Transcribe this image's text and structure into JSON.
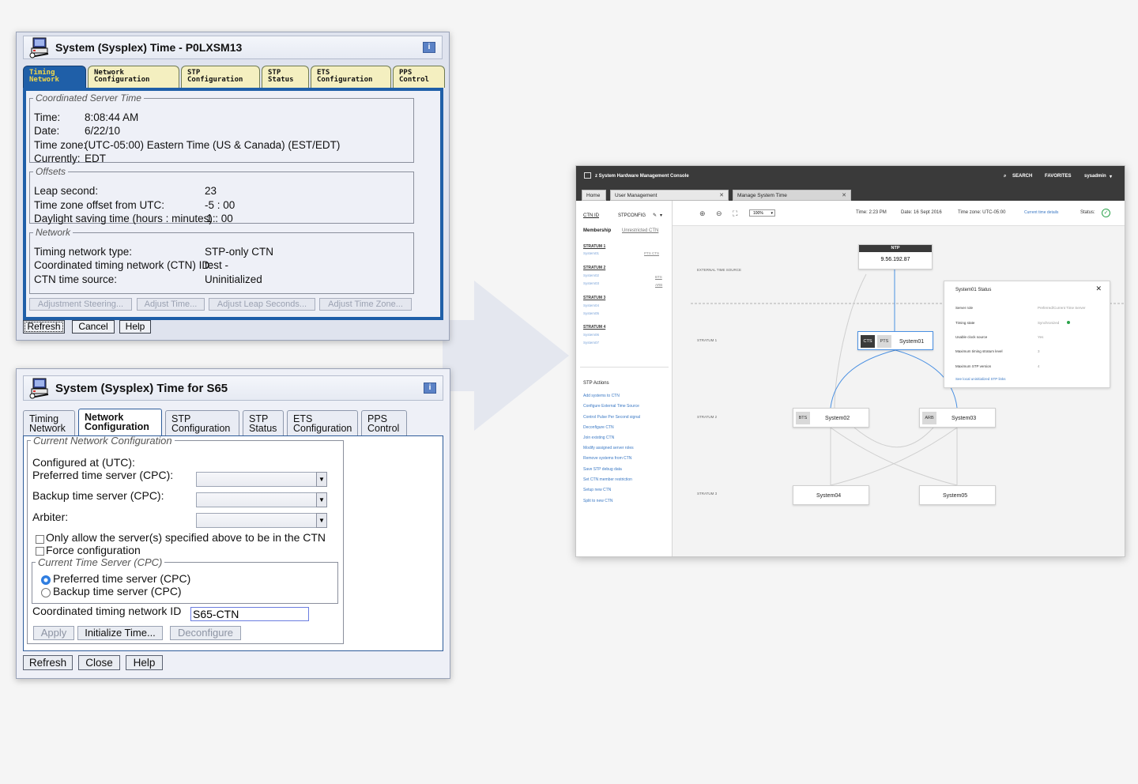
{
  "dialog1": {
    "title": "System (Sysplex) Time - P0LXSM13",
    "info_icon": "info-icon",
    "tabs": [
      {
        "line1": "Timing",
        "line2": "Network",
        "active": true
      },
      {
        "line1": "Network",
        "line2": "Configuration",
        "active": false
      },
      {
        "line1": "STP",
        "line2": "Configuration",
        "active": false
      },
      {
        "line1": "STP",
        "line2": "Status",
        "active": false
      },
      {
        "line1": "ETS",
        "line2": "Configuration",
        "active": false
      },
      {
        "line1": "PPS",
        "line2": "Control",
        "active": false
      }
    ],
    "cst": {
      "legend": "Coordinated Server Time",
      "time_label": "Time:",
      "time_value": "8:08:44 AM",
      "date_label": "Date:",
      "date_value": "6/22/10",
      "tz_label": "Time zone:",
      "tz_value": "(UTC-05:00) Eastern Time (US & Canada) (EST/EDT)",
      "currently_label": "Currently:",
      "currently_value": "EDT"
    },
    "offsets": {
      "legend": "Offsets",
      "leap_label": "Leap second:",
      "leap_value": "23",
      "tz_offset_label": "Time zone offset from UTC:",
      "tz_offset_value": "-5 : 00",
      "dst_label": "Daylight saving time (hours : minutes):",
      "dst_value": "1 : 00"
    },
    "network": {
      "legend": "Network",
      "type_label": "Timing network type:",
      "type_value": "STP-only CTN",
      "ctn_label": "Coordinated timing network (CTN) ID:",
      "ctn_value": "test -",
      "source_label": "CTN time source:",
      "source_value": "Uninitialized"
    },
    "actions": [
      "Adjustment Steering...",
      "Adjust Time...",
      "Adjust Leap Seconds...",
      "Adjust Time Zone..."
    ],
    "buttons": {
      "refresh": "Refresh",
      "cancel": "Cancel",
      "help": "Help"
    }
  },
  "dialog2": {
    "title": "System (Sysplex) Time for S65",
    "info_icon": "info-icon",
    "tabs": [
      {
        "line1": "Timing",
        "line2": "Network",
        "active": false
      },
      {
        "line1": "Network",
        "line2": "Configuration",
        "active": true
      },
      {
        "line1": "STP",
        "line2": "Configuration",
        "active": false
      },
      {
        "line1": "STP",
        "line2": "Status",
        "active": false
      },
      {
        "line1": "ETS",
        "line2": "Configuration",
        "active": false
      },
      {
        "line1": "PPS",
        "line2": "Control",
        "active": false
      }
    ],
    "legend": "Current Network Configuration",
    "configured_at": "Configured at (UTC):",
    "preferred_label": "Preferred time server (CPC):",
    "backup_label": "Backup time server (CPC):",
    "arbiter_label": "Arbiter:",
    "only_allow": "Only allow the server(s) specified above to be in the CTN",
    "force_config": "Force configuration",
    "cts_legend": "Current Time Server (CPC)",
    "radio_preferred": "Preferred time server (CPC)",
    "radio_backup": "Backup time server (CPC)",
    "ctn_id_label": "Coordinated timing network ID",
    "ctn_id_value": "S65-CTN",
    "apply": "Apply",
    "initialize": "Initialize Time...",
    "deconfigure": "Deconfigure",
    "buttons": {
      "refresh": "Refresh",
      "close": "Close",
      "help": "Help"
    }
  },
  "console": {
    "brand": "z System Hardware Management Console",
    "search": "SEARCH",
    "favorites": "FAVORITES",
    "user": "sysadmin",
    "tabs": [
      "Home",
      "User Management",
      "Manage System Time"
    ],
    "ctn_id_label": "CTN ID",
    "ctn_id_value": "STPCONFIG",
    "membership_label": "Membership",
    "membership_value": "Unrestricted CTN",
    "strata": [
      {
        "label": "STRATUM 1",
        "systems": [
          "System01"
        ],
        "roles": "PTS CTS"
      },
      {
        "label": "STRATUM 2",
        "systems": [
          "System02",
          "System03"
        ],
        "roles": "BTS ARB"
      },
      {
        "label": "STRATUM 3",
        "systems": [
          "System04",
          "System05"
        ],
        "roles": ""
      },
      {
        "label": "STRATUM 4",
        "systems": [
          "System06",
          "System07"
        ],
        "roles": ""
      }
    ],
    "actions_title": "STP Actions",
    "actions": [
      "Add systems to CTN",
      "Configure External Time Source",
      "Control Pulse Per Second signal",
      "Deconfigure CTN",
      "Join existing CTN",
      "Modify assigned server roles",
      "Remove systems from CTN",
      "Save STP debug data",
      "Set CTN member restriction",
      "Setup new CTN",
      "Split to new CTN"
    ],
    "toolbar": {
      "zoom": "100%",
      "time": "Time: 2:23 PM",
      "date": "Date: 16 Sept 2016",
      "timezone": "Time zone: UTC-05:00",
      "details": "Current time details",
      "status": "Status:"
    },
    "diagram": {
      "ext_source": "EXTERNAL TIME SOURCE",
      "stratum1": "STRATUM 1",
      "stratum2": "STRATUM 2",
      "stratum3": "STRATUM 3",
      "ntp_label": "NTP",
      "ntp_ip": "9.56.192.87",
      "nodes": {
        "s01": {
          "tags": [
            "CTS",
            "PTS"
          ],
          "name": "System01"
        },
        "s02": {
          "tag": "BTS",
          "name": "System02"
        },
        "s03": {
          "tag": "ARB",
          "name": "System03"
        },
        "s04": {
          "name": "System04"
        },
        "s05": {
          "name": "System05"
        }
      }
    },
    "status_panel": {
      "title": "System01 Status",
      "rows": [
        {
          "k": "Server role",
          "v": "Preferred/Current Time Server"
        },
        {
          "k": "Timing state",
          "v": "Synchronized"
        },
        {
          "k": "Usable clock source",
          "v": "Yes"
        },
        {
          "k": "Maximum timing stratum level",
          "v": "3"
        },
        {
          "k": "Maximum STP version",
          "v": "4"
        }
      ],
      "link": "See local uninitialized STP links"
    }
  }
}
